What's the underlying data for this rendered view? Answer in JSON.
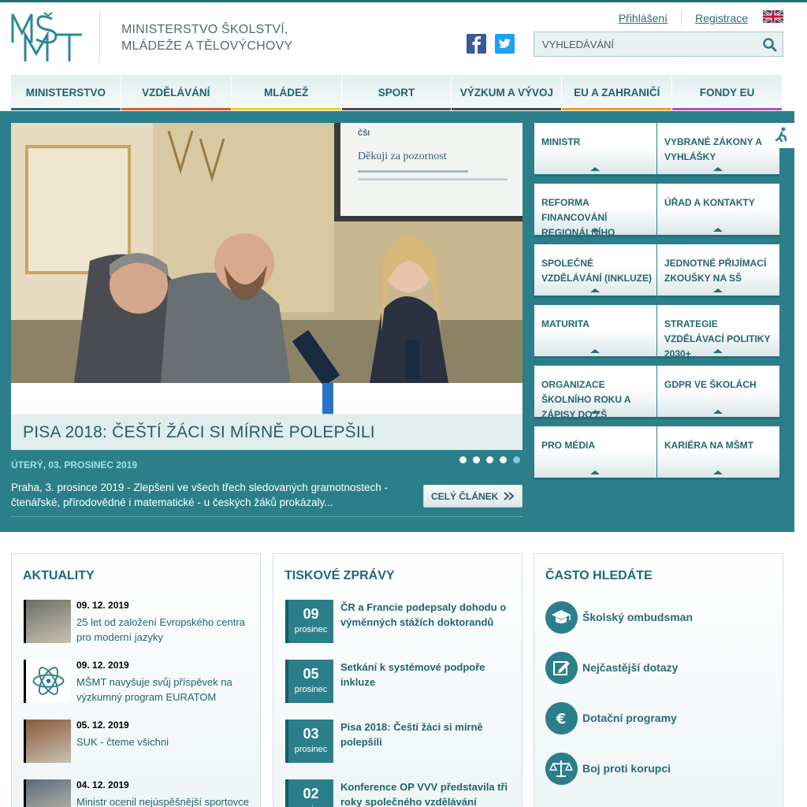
{
  "header": {
    "ministry_line1": "MINISTERSTVO ŠKOLSTVÍ,",
    "ministry_line2": "MLÁDEŽE A TĚLOVÝCHOVY",
    "logo_text": "MŠMT",
    "login": "Přihlášení",
    "register": "Registrace",
    "search_placeholder": "VYHLEDÁVÁNÍ"
  },
  "colors": {
    "brand": "#2b7f8a",
    "nav_underlines": [
      "#1f6f79",
      "#e25b26",
      "#f2d21b",
      "#4a4a4a",
      "#3a4a55",
      "#f0a11c",
      "#b44fbd"
    ]
  },
  "nav": [
    {
      "label": "MINISTERSTVO"
    },
    {
      "label": "VZDĚLÁVÁNÍ"
    },
    {
      "label": "MLÁDEŽ"
    },
    {
      "label": "SPORT"
    },
    {
      "label": "VÝZKUM A VÝVOJ"
    },
    {
      "label": "EU A ZAHRANIČÍ"
    },
    {
      "label": "FONDY EU"
    }
  ],
  "hero": {
    "photo_slide_title": "Děkuji za pozornost",
    "caption": "PISA 2018: ČEŠTÍ ŽÁCI SI MÍRNĚ POLEPŠILI",
    "date": "ÚTERÝ, 03. PROSINEC 2019",
    "text": "Praha, 3. prosince 2019 - Zlepšení ve všech třech sledovaných gramotnostech - čtenářské, přírodovědné i matematické - u českých žáků prokázaly...",
    "read_more": "CELÝ ČLÁNEK",
    "active_dot": 4
  },
  "tiles": [
    {
      "label": "MINISTR"
    },
    {
      "label": "VYBRANÉ ZÁKONY A VYHLÁŠKY"
    },
    {
      "label": "REFORMA FINANCOVÁNÍ REGIONÁLNÍHO ŠKOLSTVÍ"
    },
    {
      "label": "ÚŘAD A KONTAKTY"
    },
    {
      "label": "SPOLEČNÉ VZDĚLÁVÁNÍ (INKLUZE)"
    },
    {
      "label": "JEDNOTNÉ PŘIJÍMACÍ ZKOUŠKY NA SŠ"
    },
    {
      "label": "MATURITA"
    },
    {
      "label": "STRATEGIE VZDĚLÁVACÍ POLITIKY 2030+"
    },
    {
      "label": "ORGANIZACE ŠKOLNÍHO ROKU A ZÁPISY DO ZŠ"
    },
    {
      "label": "GDPR VE ŠKOLÁCH"
    },
    {
      "label": "PRO MÉDIA"
    },
    {
      "label": "KARIÉRA NA MŠMT"
    }
  ],
  "aktuality": {
    "heading": "AKTUALITY",
    "items": [
      {
        "date": "09. 12. 2019",
        "title": "25 let od založení Evropského centra pro moderní jazyky"
      },
      {
        "date": "09. 12. 2019",
        "title": "MŠMT navyšuje svůj příspěvek na výzkumný program EURATOM"
      },
      {
        "date": "05. 12. 2019",
        "title": "SUK - čteme všichni"
      },
      {
        "date": "04. 12. 2019",
        "title": "Ministr ocenil nejúspěšnější sportovce"
      }
    ]
  },
  "tiskove": {
    "heading": "TISKOVÉ ZPRÁVY",
    "items": [
      {
        "day": "09",
        "month": "prosinec",
        "title": "ČR a Francie podepsaly dohodu o výměnných stážích doktorandů"
      },
      {
        "day": "05",
        "month": "prosinec",
        "title": "Setkání k systémové podpoře inkluze"
      },
      {
        "day": "03",
        "month": "prosinec",
        "title": "Pisa 2018: Čeští žáci si mírně polepšili"
      },
      {
        "day": "02",
        "month": "prosinec",
        "title": "Konference OP VVV představila tři roky společného vzdělávání"
      }
    ]
  },
  "casto": {
    "heading": "ČASTO HLEDÁTE",
    "items": [
      {
        "label": "Školský ombudsman",
        "icon": "graduation-cap-icon"
      },
      {
        "label": "Nejčastější dotazy",
        "icon": "edit-icon"
      },
      {
        "label": "Dotační programy",
        "icon": "euro-icon"
      },
      {
        "label": "Boj proti korupci",
        "icon": "scales-icon"
      }
    ]
  }
}
